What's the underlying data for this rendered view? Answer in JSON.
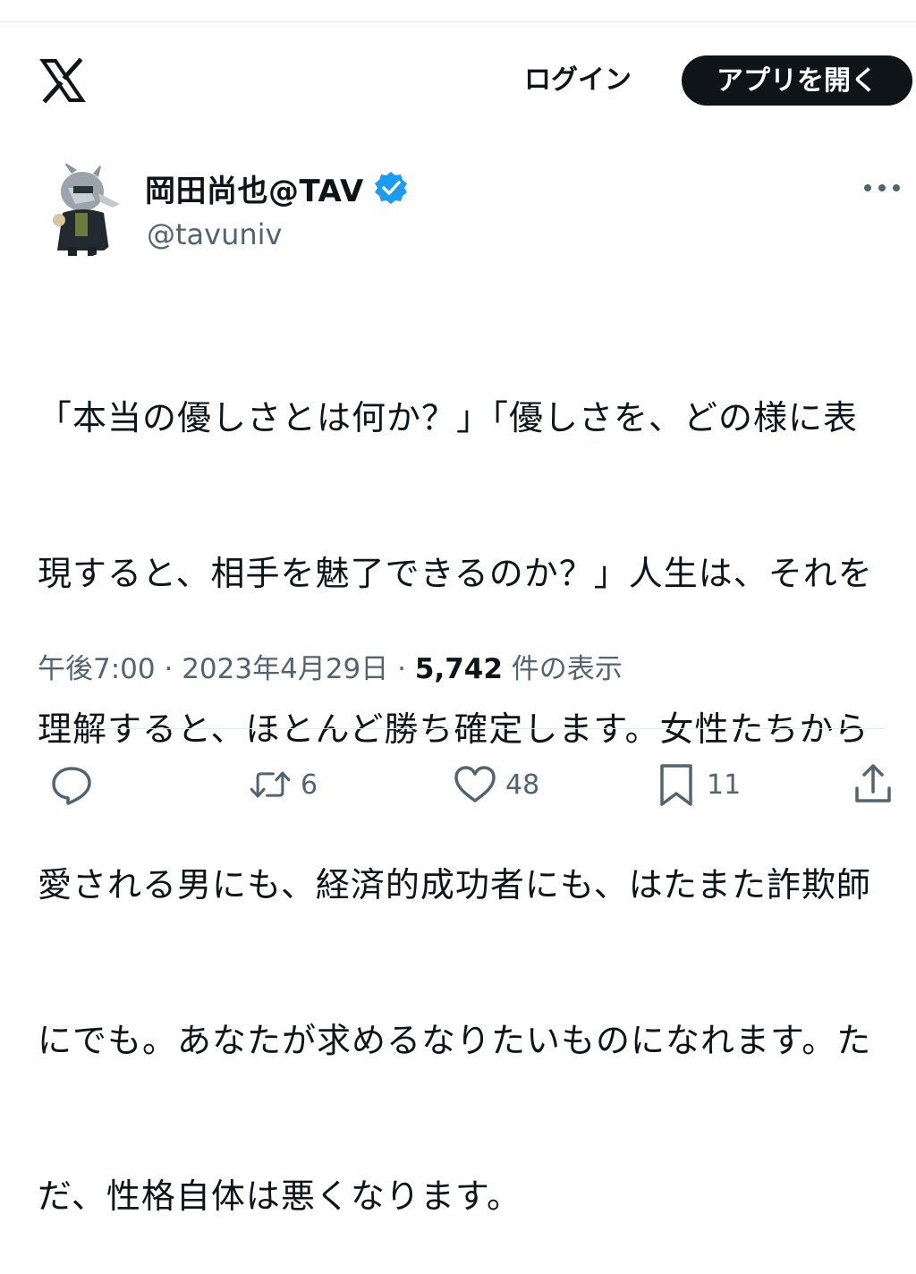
{
  "header": {
    "logo_icon": "x-logo-icon",
    "login_label": "ログイン",
    "open_app_label": "アプリを開く"
  },
  "author": {
    "display_name": "岡田尚也@TAV",
    "handle": "@tavuniv",
    "verified": true,
    "verified_color": "#1d9bf0"
  },
  "tweet": {
    "text_lines": [
      "「本当の優しさとは何か？」「優しさを、どの様に表",
      "現すると、相手を魅了できるのか？」人生は、それを",
      "理解すると、ほとんど勝ち確定します。女性たちから",
      "愛される男にも、経済的成功者にも、はたまた詐欺師",
      "にでも。あなたが求めるなりたいものになれます。た",
      "だ、性格自体は悪くなります。"
    ],
    "time": "午後7:00",
    "date": "2023年4月29日",
    "separator": "·",
    "views_count": "5,742",
    "views_label": "件の表示"
  },
  "actions": {
    "reply_count": "",
    "retweet_count": "6",
    "like_count": "48",
    "bookmark_count": "11"
  },
  "colors": {
    "text_primary": "#0f1419",
    "text_secondary": "#536471",
    "button_dark": "#0f1419",
    "divider": "#e6e9eb"
  }
}
